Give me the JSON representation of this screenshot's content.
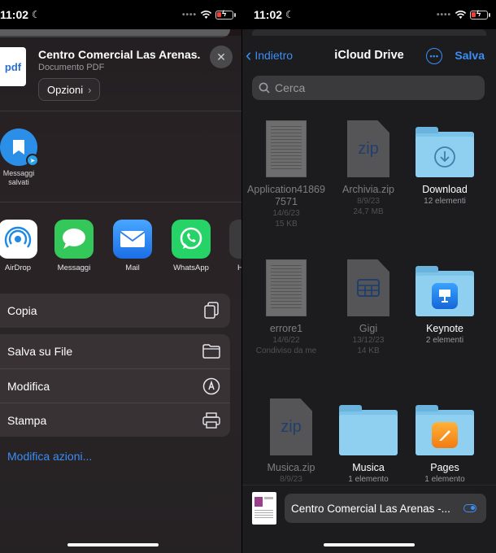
{
  "status": {
    "time": "11:02"
  },
  "share_sheet": {
    "doc_title": "Centro Comercial Las Arenas...",
    "doc_subtitle": "Documento PDF",
    "doc_badge": "pdf",
    "options_label": "Opzioni",
    "contact": {
      "label": "Messaggi salvati"
    },
    "apps": [
      {
        "label": "AirDrop",
        "color": "#ffffff"
      },
      {
        "label": "Messaggi",
        "color": "#34c759"
      },
      {
        "label": "Mail",
        "color": "#2a8af0"
      },
      {
        "label": "WhatsApp",
        "color": "#25d366"
      },
      {
        "label": "H"
      }
    ],
    "actions": {
      "copy": "Copia",
      "save_to_files": "Salva su File",
      "edit": "Modifica",
      "print": "Stampa"
    },
    "edit_actions": "Modifica azioni..."
  },
  "files": {
    "back_label": "Indietro",
    "title": "iCloud Drive",
    "save_label": "Salva",
    "search_placeholder": "Cerca",
    "items": [
      {
        "name": "Application418697571",
        "date": "14/6/23",
        "size": "15 KB",
        "kind": "document",
        "dimmed": true
      },
      {
        "name": "Archivia.zip",
        "date": "8/9/23",
        "size": "24,7 MB",
        "kind": "zip",
        "badge": "zip",
        "dimmed": true
      },
      {
        "name": "Download",
        "count": "12 elementi",
        "kind": "folder"
      },
      {
        "name": "errore1",
        "date": "14/6/22",
        "size": "Condiviso da me",
        "kind": "document",
        "dimmed": true
      },
      {
        "name": "Gigi",
        "date": "13/12/23",
        "size": "14 KB",
        "kind": "spreadsheet",
        "dimmed": true
      },
      {
        "name": "Keynote",
        "count": "2 elementi",
        "kind": "folder"
      },
      {
        "name": "Musica.zip",
        "date": "8/9/23",
        "kind": "zip",
        "badge": "zip",
        "dimmed": true
      },
      {
        "name": "Musica",
        "count": "1 elemento",
        "kind": "folder"
      },
      {
        "name": "Pages",
        "count": "1 elemento",
        "kind": "folder"
      }
    ],
    "filename_value": "Centro Comercial Las Arenas -..."
  },
  "colors": {
    "accent": "#3a8ef6",
    "folder": "#7cc3ea",
    "battery_low": "#ff3b30"
  }
}
